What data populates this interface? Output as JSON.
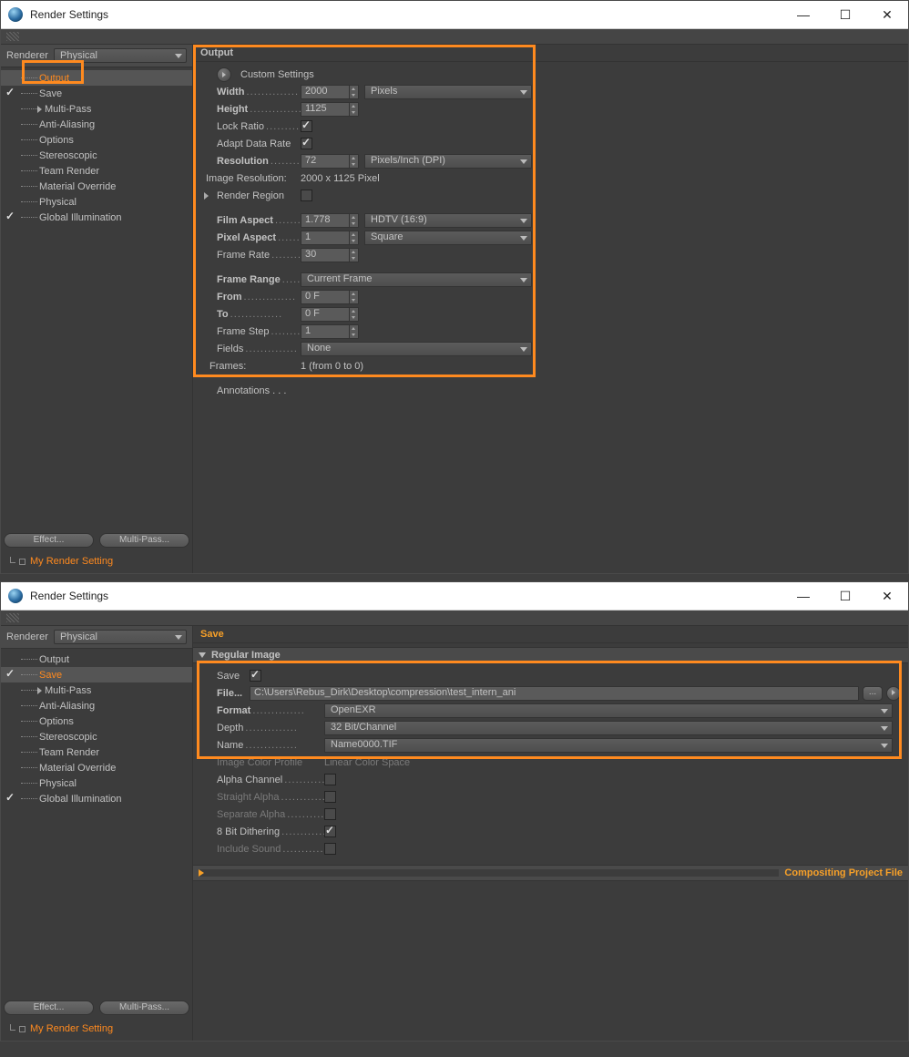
{
  "window_title": "Render Settings",
  "renderer": {
    "label": "Renderer",
    "value": "Physical"
  },
  "tree": {
    "items": [
      {
        "label": "Output",
        "cb": "spacer",
        "active": true,
        "sel": true
      },
      {
        "label": "Save",
        "cb": "on"
      },
      {
        "label": "Multi-Pass",
        "cb": "off",
        "exp": true
      },
      {
        "label": "Anti-Aliasing",
        "cb": "spacer"
      },
      {
        "label": "Options",
        "cb": "spacer"
      },
      {
        "label": "Stereoscopic",
        "cb": "off"
      },
      {
        "label": "Team Render",
        "cb": "off"
      },
      {
        "label": "Material Override",
        "cb": "off"
      },
      {
        "label": "Physical",
        "cb": "spacer"
      },
      {
        "label": "Global Illumination",
        "cb": "on"
      }
    ]
  },
  "tree2": {
    "items": [
      {
        "label": "Output",
        "cb": "spacer"
      },
      {
        "label": "Save",
        "cb": "on",
        "active": true,
        "sel": true
      },
      {
        "label": "Multi-Pass",
        "cb": "off",
        "exp": true
      },
      {
        "label": "Anti-Aliasing",
        "cb": "spacer"
      },
      {
        "label": "Options",
        "cb": "spacer"
      },
      {
        "label": "Stereoscopic",
        "cb": "off"
      },
      {
        "label": "Team Render",
        "cb": "off"
      },
      {
        "label": "Material Override",
        "cb": "off"
      },
      {
        "label": "Physical",
        "cb": "spacer"
      },
      {
        "label": "Global Illumination",
        "cb": "on"
      }
    ]
  },
  "buttons": {
    "effect": "Effect...",
    "multipass": "Multi-Pass..."
  },
  "setting_name": "My Render Setting",
  "output": {
    "title": "Output",
    "custom": "Custom Settings",
    "width": {
      "label": "Width",
      "value": "2000",
      "unit": "Pixels"
    },
    "height": {
      "label": "Height",
      "value": "1125"
    },
    "lockratio": {
      "label": "Lock Ratio",
      "checked": true
    },
    "adapt": {
      "label": "Adapt Data Rate",
      "checked": true
    },
    "resolution": {
      "label": "Resolution",
      "value": "72",
      "unit": "Pixels/Inch (DPI)"
    },
    "imgres": {
      "label": "Image Resolution:",
      "value": "2000 x 1125 Pixel"
    },
    "renderregion": {
      "label": "Render Region",
      "checked": false
    },
    "filmaspect": {
      "label": "Film Aspect",
      "value": "1.778",
      "preset": "HDTV (16:9)"
    },
    "pixelaspect": {
      "label": "Pixel Aspect",
      "value": "1",
      "preset": "Square"
    },
    "framerate": {
      "label": "Frame Rate",
      "value": "30"
    },
    "framerange": {
      "label": "Frame Range",
      "value": "Current Frame"
    },
    "from": {
      "label": "From",
      "value": "0 F"
    },
    "to": {
      "label": "To",
      "value": "0 F"
    },
    "framestep": {
      "label": "Frame Step",
      "value": "1"
    },
    "fields": {
      "label": "Fields",
      "value": "None"
    },
    "frames": {
      "label": "Frames:",
      "value": "1 (from 0 to 0)"
    },
    "annotations": "Annotations . . ."
  },
  "save": {
    "title": "Save",
    "section_regular": "Regular Image",
    "save": {
      "label": "Save",
      "checked": true
    },
    "file": {
      "label": "File...",
      "value": "C:\\Users\\Rebus_Dirk\\Desktop\\compression\\test_intern_ani",
      "browse": "..."
    },
    "format": {
      "label": "Format",
      "value": "OpenEXR"
    },
    "depth": {
      "label": "Depth",
      "value": "32 Bit/Channel"
    },
    "name": {
      "label": "Name",
      "value": "Name0000.TIF"
    },
    "colorprofile": {
      "label": "Image Color Profile",
      "value": "Linear Color Space"
    },
    "alpha": {
      "label": "Alpha Channel",
      "checked": false
    },
    "straight": {
      "label": "Straight Alpha",
      "checked": false
    },
    "sepalpha": {
      "label": "Separate Alpha",
      "checked": false
    },
    "dither": {
      "label": "8 Bit Dithering",
      "checked": true
    },
    "sound": {
      "label": "Include Sound",
      "checked": false
    },
    "section_comp": "Compositing Project File"
  },
  "colors": {
    "highlight": "#ff8a1f"
  }
}
